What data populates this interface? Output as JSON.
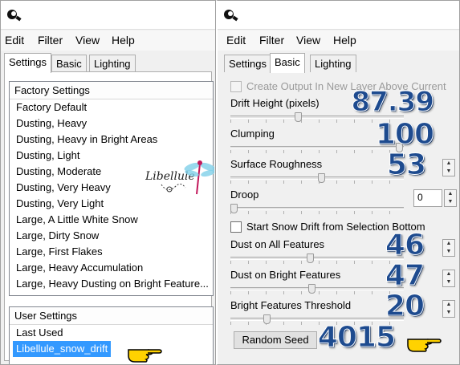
{
  "left": {
    "menu": [
      "Edit",
      "Filter",
      "View",
      "Help"
    ],
    "tabs": [
      "Settings",
      "Basic",
      "Lighting"
    ],
    "factory": {
      "header": "Factory Settings",
      "items": [
        "Factory Default",
        "Dusting, Heavy",
        "Dusting, Heavy in Bright Areas",
        "Dusting, Light",
        "Dusting, Moderate",
        "Dusting, Very Heavy",
        "Dusting, Very Light",
        "Large, A Little White Snow",
        "Large, Dirty Snow",
        "Large, First Flakes",
        "Large, Heavy Accumulation",
        "Large, Heavy Dusting on Bright Feature..."
      ]
    },
    "user": {
      "header": "User Settings",
      "items": [
        "Last Used",
        "Libellule_snow_drift"
      ]
    },
    "logo_text": "Libellule"
  },
  "right": {
    "menu": [
      "Edit",
      "Filter",
      "View",
      "Help"
    ],
    "tabs": [
      "Settings",
      "Basic",
      "Lighting"
    ],
    "create_output": "Create Output In New Layer Above Current",
    "start_drift": "Start Snow Drift from Selection Bottom",
    "params": {
      "drift_height": {
        "label": "Drift Height (pixels)",
        "value": "87.39",
        "level": 0.39
      },
      "clumping": {
        "label": "Clumping",
        "value": "100",
        "level": 1.0
      },
      "surface_roughness": {
        "label": "Surface Roughness",
        "value": "53",
        "level": 0.53
      },
      "droop": {
        "label": "Droop",
        "value": "0",
        "level": 0.0
      },
      "dust_all": {
        "label": "Dust on All Features",
        "value": "46",
        "level": 0.46
      },
      "dust_bright": {
        "label": "Dust on Bright Features",
        "value": "47",
        "level": 0.47
      },
      "bright_threshold": {
        "label": "Bright Features Threshold",
        "value": "20",
        "level": 0.2
      }
    },
    "random_seed": {
      "label": "Random Seed",
      "value": "4015"
    }
  },
  "colors": {
    "selection": "#3399ff",
    "annotation_blue": "#1e4b8f",
    "hand_yellow": "#ffd200"
  }
}
